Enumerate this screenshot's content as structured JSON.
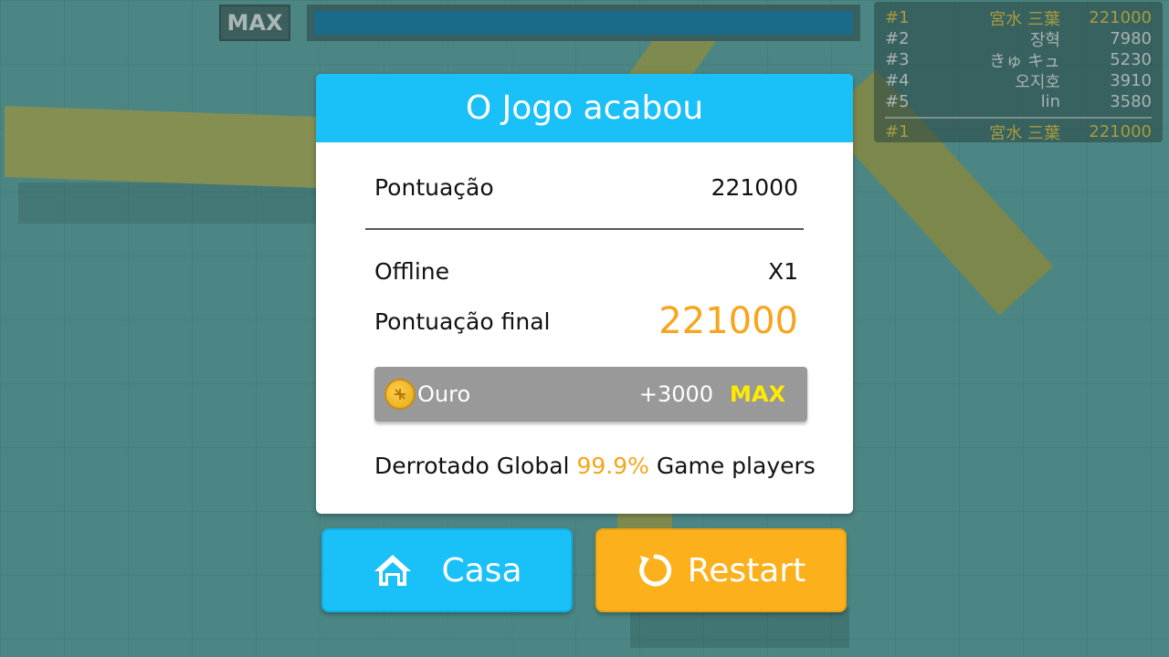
{
  "top_bar": {
    "max_label": "MAX",
    "progress": 1.0,
    "progress_color": "#1a6a8a"
  },
  "leaderboard": {
    "rows": [
      {
        "rank": "#1",
        "name": "宮水 三葉",
        "score": "221000",
        "highlight": true
      },
      {
        "rank": "#2",
        "name": "장혁",
        "score": "7980"
      },
      {
        "rank": "#3",
        "name": "きゅ キュ",
        "score": "5230"
      },
      {
        "rank": "#4",
        "name": "오지호",
        "score": "3910"
      },
      {
        "rank": "#5",
        "name": "lin",
        "score": "3580"
      }
    ],
    "self": {
      "rank": "#1",
      "name": "宮水 三葉",
      "score": "221000"
    }
  },
  "dialog": {
    "title": "O Jogo acabou",
    "score_label": "Pontuação",
    "score_value": "221000",
    "mode_label": "Offline",
    "multiplier": "X1",
    "final_label": "Pontuação final",
    "final_value": "221000",
    "gold": {
      "label": "Ouro",
      "amount": "+3000",
      "max": "MAX",
      "icon": "coin-icon"
    },
    "defeated_prefix": "Derrotado Global",
    "defeated_percent": "99.9%",
    "defeated_suffix": "Game players"
  },
  "buttons": {
    "home": {
      "label": "Casa",
      "icon": "home-icon"
    },
    "restart": {
      "label": "Restart",
      "icon": "restart-icon"
    }
  },
  "colors": {
    "accent_blue": "#1ac0f8",
    "accent_orange": "#fbb01c",
    "highlight_orange": "#f7a51a",
    "gold_max": "#ffea00"
  }
}
